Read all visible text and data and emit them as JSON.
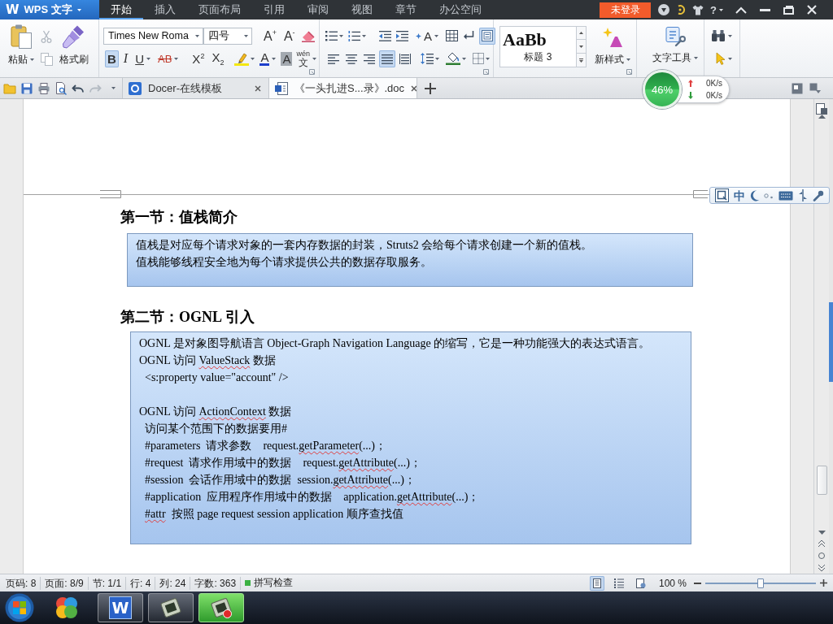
{
  "title_bar": {
    "app_menu": {
      "logo": "W",
      "label": "WPS 文字"
    },
    "tabs": [
      {
        "label": "开始",
        "selected": true
      },
      {
        "label": "插入",
        "selected": false
      },
      {
        "label": "页面布局",
        "selected": false
      },
      {
        "label": "引用",
        "selected": false
      },
      {
        "label": "审阅",
        "selected": false
      },
      {
        "label": "视图",
        "selected": false
      },
      {
        "label": "章节",
        "selected": false
      },
      {
        "label": "办公空间",
        "selected": false
      }
    ],
    "login_button": "未登录",
    "help_label": "?"
  },
  "ribbon": {
    "clipboard": {
      "paste_label": "粘贴",
      "format_painter_label": "格式刷",
      "cut_disabled": true,
      "copy_disabled": true
    },
    "font": {
      "font_name": "Times New Roma",
      "font_size": "四号",
      "grow_label": "A$^{+}$",
      "shrink_label": "A$^{-}$",
      "format_buttons": [
        {
          "label": "B",
          "kind": "bold",
          "pressed": true
        },
        {
          "label": "I",
          "kind": "italic",
          "pressed": false
        },
        {
          "label": "U",
          "kind": "underline",
          "pressed": false
        },
        {
          "label": "AB",
          "kind": "strikethrough",
          "pressed": false
        },
        {
          "label": "X$^{2}$",
          "kind": "script",
          "pressed": false
        },
        {
          "label": "X$_{2}$",
          "kind": "script",
          "pressed": false
        }
      ],
      "font_color_label": "A",
      "shading_label": "A",
      "phonetic_guide": {
        "ruby": "wén",
        "base": "文"
      }
    },
    "paragraph": {
      "text_effect_label": "A",
      "grid_pressed": true,
      "alignments": [
        {
          "selected": false
        },
        {
          "selected": false
        },
        {
          "selected": false
        },
        {
          "selected": true
        },
        {
          "selected": false
        }
      ]
    },
    "styles": {
      "sample": "AaBb",
      "style_name": "标题 3",
      "new_style_label": "新样式"
    },
    "text_tools_label": "文字工具"
  },
  "quick_access": {
    "redo_disabled": true
  },
  "document_tabs": [
    {
      "label": "Docer-在线模板",
      "selected": false
    },
    {
      "label": "《一头扎进S...录》.doc",
      "selected": true
    }
  ],
  "network_monitor": {
    "usage": "46%",
    "upload": "0K/s",
    "download": "0K/s"
  },
  "ime_toolbar": {
    "mode": "中"
  },
  "document": {
    "sections": [
      {
        "heading": "第一节：值栈简介",
        "paragraphs": [
          {
            "lines": [
              {
                "segments": [
                  {
                    "text": "值栈是对应每个请求对象的一套内存数据的封装，Struts2 会给每个请求创建一个新的值栈。",
                    "misspelled": false
                  }
                ]
              },
              {
                "segments": [
                  {
                    "text": "值栈能够线程安全地为每个请求提供公共的数据存取服务。",
                    "misspelled": false
                  }
                ]
              }
            ]
          }
        ]
      },
      {
        "heading": "第二节：OGNL 引入",
        "paragraphs": [
          {
            "lines": [
              {
                "segments": [
                  {
                    "text": "OGNL 是对象图导航语言 Object-Graph Navigation Language 的缩写，它是一种功能强大的表达式语言。",
                    "misspelled": false
                  }
                ]
              },
              {
                "segments": [
                  {
                    "text": "OGNL 访问 ",
                    "misspelled": false
                  },
                  {
                    "text": "ValueStack",
                    "misspelled": true
                  },
                  {
                    "text": " 数据",
                    "misspelled": false
                  }
                ],
                "children": [
                  {
                    "segments": [
                      {
                        "text": "<s:property value=\"account\" />",
                        "misspelled": false
                      }
                    ]
                  }
                ]
              }
            ]
          },
          {
            "lines": [
              {
                "segments": [
                  {
                    "text": "OGNL 访问 ",
                    "misspelled": false
                  },
                  {
                    "text": "ActionContext",
                    "misspelled": true
                  },
                  {
                    "text": " 数据",
                    "misspelled": false
                  }
                ],
                "children": [
                  {
                    "segments": [
                      {
                        "text": "访问某个范围下的数据要用#",
                        "misspelled": false
                      }
                    ]
                  },
                  {
                    "segments": [
                      {
                        "text": "#parameters  请求参数    request.",
                        "misspelled": false
                      },
                      {
                        "text": "getParameter",
                        "misspelled": true
                      },
                      {
                        "text": "(...)；",
                        "misspelled": false
                      }
                    ]
                  },
                  {
                    "segments": [
                      {
                        "text": "#request  请求作用域中的数据    request.",
                        "misspelled": false
                      },
                      {
                        "text": "getAttribute",
                        "misspelled": true
                      },
                      {
                        "text": "(...)；",
                        "misspelled": false
                      }
                    ]
                  },
                  {
                    "segments": [
                      {
                        "text": "#session  会话作用域中的数据  session.",
                        "misspelled": false
                      },
                      {
                        "text": "getAttribute",
                        "misspelled": true
                      },
                      {
                        "text": "(...)；",
                        "misspelled": false
                      }
                    ]
                  },
                  {
                    "segments": [
                      {
                        "text": "#application  应用程序作用域中的数据    application.",
                        "misspelled": false
                      },
                      {
                        "text": "getAttribute",
                        "misspelled": true
                      },
                      {
                        "text": "(...)；",
                        "misspelled": false
                      }
                    ]
                  },
                  {
                    "segments": [
                      {
                        "text": "#attr",
                        "misspelled": true
                      },
                      {
                        "text": "  按照 page request session application 顺序查找值",
                        "misspelled": false
                      }
                    ]
                  }
                ]
              }
            ]
          }
        ]
      }
    ]
  },
  "status_bar": {
    "fields": [
      "页码: 8",
      "页面: 8/9",
      "节: 1/1",
      "行: 4",
      "列: 24",
      "字数: 363"
    ],
    "spell_check": {
      "label": "拼写检查",
      "on": true
    },
    "view_modes": [
      {
        "selected": true
      },
      {
        "selected": false
      },
      {
        "selected": false
      }
    ],
    "zoom": {
      "label": "100 %",
      "level": 0.5
    }
  },
  "taskbar": {
    "apps": [
      {
        "running": false,
        "selected": false
      },
      {
        "running": true,
        "selected": false,
        "logo": "W"
      },
      {
        "running": true,
        "selected": false
      },
      {
        "running": true,
        "selected": true
      }
    ]
  }
}
